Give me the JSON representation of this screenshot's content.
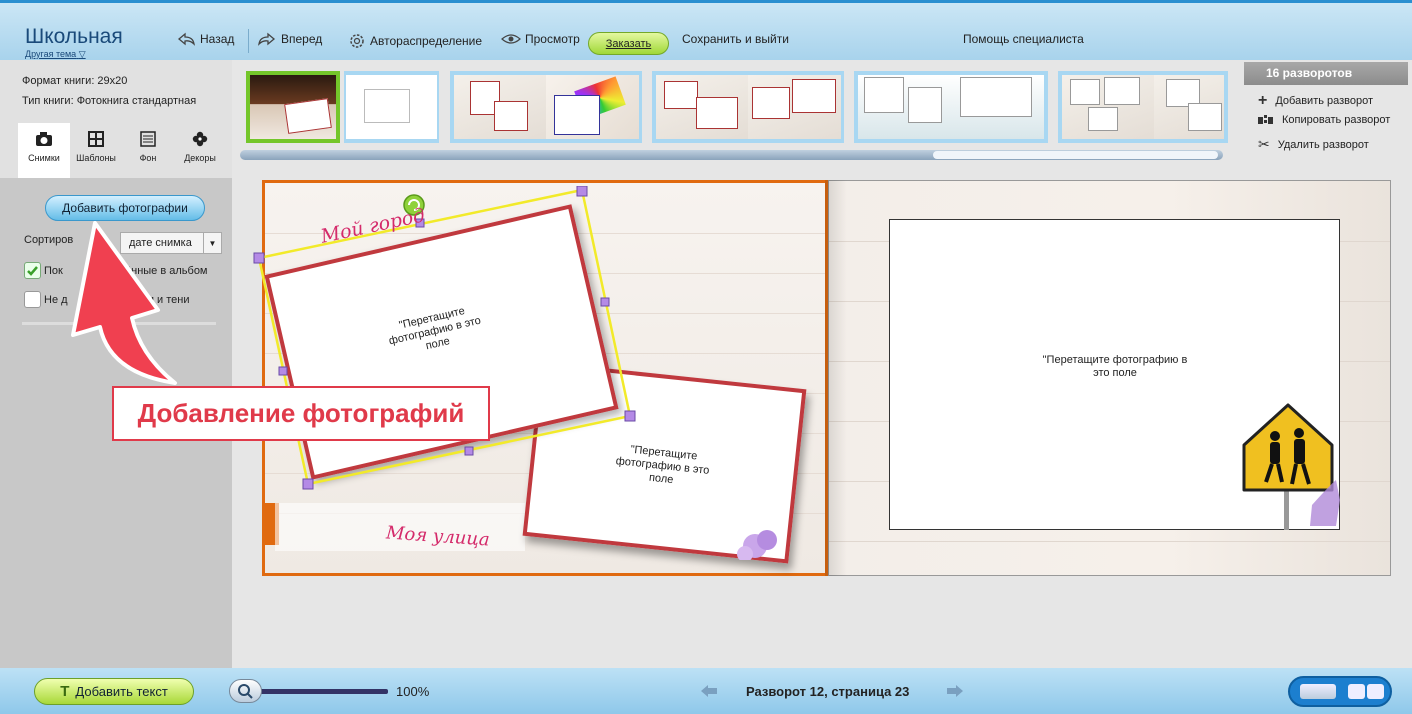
{
  "topbar": {
    "theme_title": "Школьная",
    "theme_link": "Другая тема",
    "back": "Назад",
    "forward": "Вперед",
    "autodistribute": "Автораспределение",
    "preview": "Просмотр",
    "order": "Заказать",
    "save_exit": "Сохранить и выйти",
    "help": "Помощь специалиста"
  },
  "left_panel": {
    "book_format": "Формат книги: 29x20",
    "book_type": "Тип книги: Фотокнига стандартная",
    "tabs": [
      {
        "label": "Снимки",
        "icon": "camera-icon"
      },
      {
        "label": "Шаблоны",
        "icon": "templates-icon"
      },
      {
        "label": "Фон",
        "icon": "background-icon"
      },
      {
        "label": "Декоры",
        "icon": "decor-icon"
      }
    ],
    "add_photos": "Добавить фотографии",
    "sort_label": "Сортиров",
    "sort_value": "дате снимка",
    "check1_label_a": "Пок",
    "check1_label_b": "ённые в альбом",
    "check2_label_a": "Не д",
    "check2_label_b": "тки и тени"
  },
  "right_panel": {
    "spreads_count": "16 разворотов",
    "add_spread": "Добавить разворот",
    "copy_spread": "Копировать разворот",
    "delete_spread": "Удалить разворот"
  },
  "canvas": {
    "caption_city": "Мой город",
    "caption_street": "Моя улица",
    "drop_placeholder_1": "\"Перетащите фотографию в это поле",
    "drop_placeholder_2": "\"Перетащите фотографию в это поле",
    "drop_placeholder_3": "\"Перетащите фотографию в это поле"
  },
  "callout": {
    "text": "Добавление фотографий"
  },
  "bottombar": {
    "add_text": "Добавить текст",
    "zoom": "100%",
    "spread_info": "Разворот 12, страница 23"
  }
}
